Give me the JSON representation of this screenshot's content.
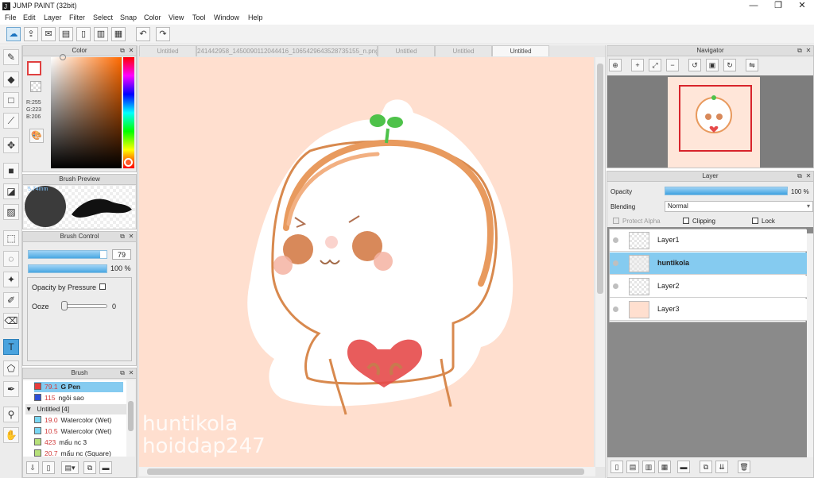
{
  "app": {
    "title": "JUMP PAINT (32bit)",
    "window_controls": [
      "—",
      "❐",
      "✕"
    ]
  },
  "menu": [
    "File",
    "Edit",
    "Layer",
    "Filter",
    "Select",
    "Snap",
    "Color",
    "View",
    "Tool",
    "Window",
    "Help"
  ],
  "toolbar": {
    "buttons": [
      "cloud-icon",
      "export-icon",
      "comment-icon",
      "board-icon",
      "page-icon",
      "pages-icon",
      "grid-icon"
    ],
    "undo": "↶",
    "redo": "↷"
  },
  "tools": [
    "brush-icon",
    "eraser-icon",
    "rect-icon",
    "line-icon",
    "move-icon",
    "fill-square-icon",
    "bucket-icon",
    "gradient-icon",
    "rect-select-icon",
    "lasso-icon",
    "magic-wand-icon",
    "select-pen-icon",
    "select-eraser-icon",
    "text-icon",
    "polygon-select-icon",
    "pen-icon",
    "eyedropper-icon",
    "hand-icon"
  ],
  "color_panel": {
    "title": "Color",
    "r": "R:255",
    "g": "G:223",
    "b": "B:206",
    "primary": "#ffdfce",
    "accent": "#e04040"
  },
  "brush_preview": {
    "title": "Brush Preview",
    "size": "5.74mm"
  },
  "brush_control": {
    "title": "Brush Control",
    "size_value": "79",
    "opacity_value": "100 %",
    "opacity_by_pressure": "Opacity by Pressure",
    "ooze_label": "Ooze",
    "ooze_value": "0"
  },
  "brush_panel": {
    "title": "Brush",
    "items": [
      {
        "value": "79.1",
        "name": "G Pen",
        "color": "#e83c3c",
        "selected": true,
        "bold": true
      },
      {
        "value": "115",
        "name": "ngôi sao",
        "color": "#2d4fd8",
        "selected": false
      },
      {
        "group": "Untitled [4]"
      },
      {
        "value": "19.0",
        "name": "Watercolor (Wet)",
        "color": "#79d6f2",
        "selected": false
      },
      {
        "value": "10.5",
        "name": "Watercolor (Wet)",
        "color": "#79d6f2",
        "selected": false
      },
      {
        "value": "423",
        "name": "mẩu nc 3",
        "color": "#b6e07a",
        "selected": false
      },
      {
        "value": "20.7",
        "name": "mẩu nc (Square)",
        "color": "#b6e07a",
        "selected": false
      }
    ]
  },
  "tabs": [
    {
      "label": "Untitled",
      "active": false
    },
    {
      "label": "241442958_1450090112044416_1065429643528735155_n.png",
      "active": false
    },
    {
      "label": "Untitled",
      "active": false
    },
    {
      "label": "Untitled",
      "active": false
    },
    {
      "label": "Untitled",
      "active": true
    }
  ],
  "canvas": {
    "background": "#ffdfcf",
    "watermark1": "huntikola",
    "watermark2": "hoiddap247"
  },
  "navigator": {
    "title": "Navigator"
  },
  "layer_panel": {
    "title": "Layer",
    "opacity_label": "Opacity",
    "opacity_value": "100 %",
    "blending_label": "Blending",
    "blending_value": "Normal",
    "protect_alpha": "Protect Alpha",
    "clipping": "Clipping",
    "lock": "Lock",
    "layers": [
      {
        "name": "Layer1",
        "selected": false
      },
      {
        "name": "huntikola",
        "selected": true
      },
      {
        "name": "Layer2",
        "selected": false
      },
      {
        "name": "Layer3",
        "selected": false
      }
    ]
  }
}
